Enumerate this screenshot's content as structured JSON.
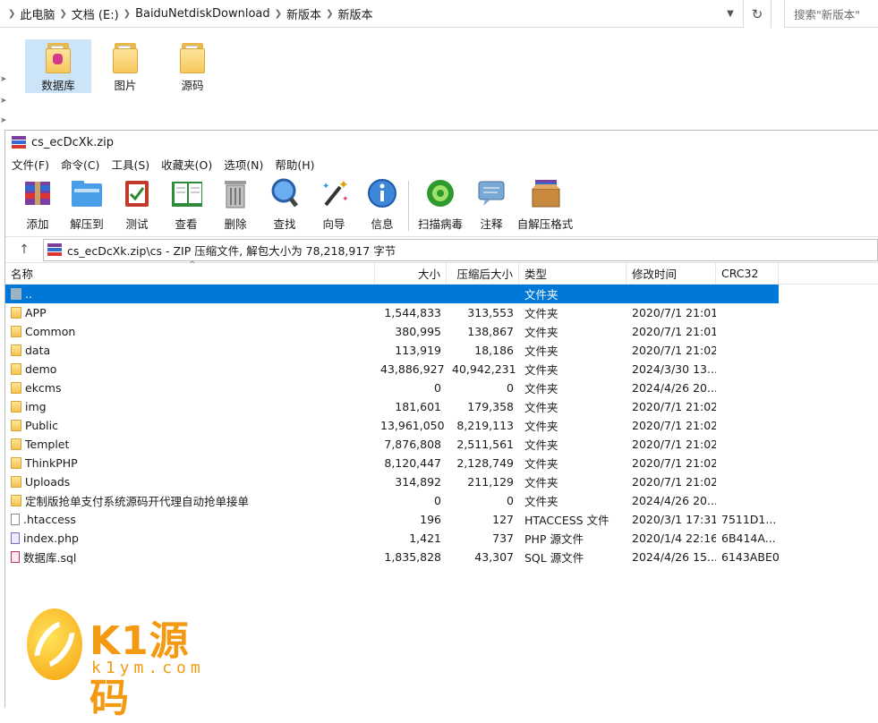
{
  "explorer": {
    "breadcrumbs": [
      "此电脑",
      "文档 (E:)",
      "BaiduNetdiskDownload",
      "新版本",
      "新版本"
    ],
    "search_placeholder": "搜索\"新版本\"",
    "folders": [
      {
        "label": "数据库",
        "selected": true
      },
      {
        "label": "图片",
        "selected": false
      },
      {
        "label": "源码",
        "selected": false
      }
    ]
  },
  "rar": {
    "title": "cs_ecDcXk.zip",
    "menu": [
      "文件(F)",
      "命令(C)",
      "工具(S)",
      "收藏夹(O)",
      "选项(N)",
      "帮助(H)"
    ],
    "toolbar": [
      {
        "label": "添加",
        "icon": "add-archive-icon"
      },
      {
        "label": "解压到",
        "icon": "extract-to-icon"
      },
      {
        "label": "测试",
        "icon": "test-icon"
      },
      {
        "label": "查看",
        "icon": "view-book-icon"
      },
      {
        "label": "删除",
        "icon": "trash-icon"
      },
      {
        "label": "查找",
        "icon": "magnifier-icon"
      },
      {
        "label": "向导",
        "icon": "wizard-wand-icon"
      },
      {
        "label": "信息",
        "icon": "info-icon"
      },
      {
        "label": "扫描病毒",
        "icon": "virus-scan-icon"
      },
      {
        "label": "注释",
        "icon": "comment-icon"
      },
      {
        "label": "自解压格式",
        "icon": "sfx-box-icon"
      }
    ],
    "path_text": "cs_ecDcXk.zip\\cs - ZIP 压缩文件, 解包大小为 78,218,917 字节",
    "columns": [
      "名称",
      "大小",
      "压缩后大小",
      "类型",
      "修改时间",
      "CRC32"
    ],
    "rows": [
      {
        "name": "..",
        "size": "",
        "csize": "",
        "type": "文件夹",
        "time": "",
        "crc": "",
        "icon": "up",
        "selected": true
      },
      {
        "name": "APP",
        "size": "1,544,833",
        "csize": "313,553",
        "type": "文件夹",
        "time": "2020/7/1 21:01",
        "crc": "",
        "icon": "folder"
      },
      {
        "name": "Common",
        "size": "380,995",
        "csize": "138,867",
        "type": "文件夹",
        "time": "2020/7/1 21:01",
        "crc": "",
        "icon": "folder"
      },
      {
        "name": "data",
        "size": "113,919",
        "csize": "18,186",
        "type": "文件夹",
        "time": "2020/7/1 21:02",
        "crc": "",
        "icon": "folder"
      },
      {
        "name": "demo",
        "size": "43,886,927",
        "csize": "40,942,231",
        "type": "文件夹",
        "time": "2024/3/30 13...",
        "crc": "",
        "icon": "folder"
      },
      {
        "name": "ekcms",
        "size": "0",
        "csize": "0",
        "type": "文件夹",
        "time": "2024/4/26 20...",
        "crc": "",
        "icon": "folder"
      },
      {
        "name": "img",
        "size": "181,601",
        "csize": "179,358",
        "type": "文件夹",
        "time": "2020/7/1 21:02",
        "crc": "",
        "icon": "folder"
      },
      {
        "name": "Public",
        "size": "13,961,050",
        "csize": "8,219,113",
        "type": "文件夹",
        "time": "2020/7/1 21:02",
        "crc": "",
        "icon": "folder"
      },
      {
        "name": "Templet",
        "size": "7,876,808",
        "csize": "2,511,561",
        "type": "文件夹",
        "time": "2020/7/1 21:02",
        "crc": "",
        "icon": "folder"
      },
      {
        "name": "ThinkPHP",
        "size": "8,120,447",
        "csize": "2,128,749",
        "type": "文件夹",
        "time": "2020/7/1 21:02",
        "crc": "",
        "icon": "folder"
      },
      {
        "name": "Uploads",
        "size": "314,892",
        "csize": "211,129",
        "type": "文件夹",
        "time": "2020/7/1 21:02",
        "crc": "",
        "icon": "folder"
      },
      {
        "name": "定制版抢单支付系统源码开代理自动抢单接单",
        "size": "0",
        "csize": "0",
        "type": "文件夹",
        "time": "2024/4/26 20...",
        "crc": "",
        "icon": "folder"
      },
      {
        "name": ".htaccess",
        "size": "196",
        "csize": "127",
        "type": "HTACCESS 文件",
        "time": "2020/3/1 17:31",
        "crc": "7511D1...",
        "icon": "file"
      },
      {
        "name": "index.php",
        "size": "1,421",
        "csize": "737",
        "type": "PHP 源文件",
        "time": "2020/1/4 22:16",
        "crc": "6B414A...",
        "icon": "php"
      },
      {
        "name": "数据库.sql",
        "size": "1,835,828",
        "csize": "43,307",
        "type": "SQL 源文件",
        "time": "2024/4/26 15...",
        "crc": "6143ABE0",
        "icon": "sql"
      }
    ]
  },
  "watermark": {
    "brand": "K1源码",
    "site": "k1ym.com"
  }
}
